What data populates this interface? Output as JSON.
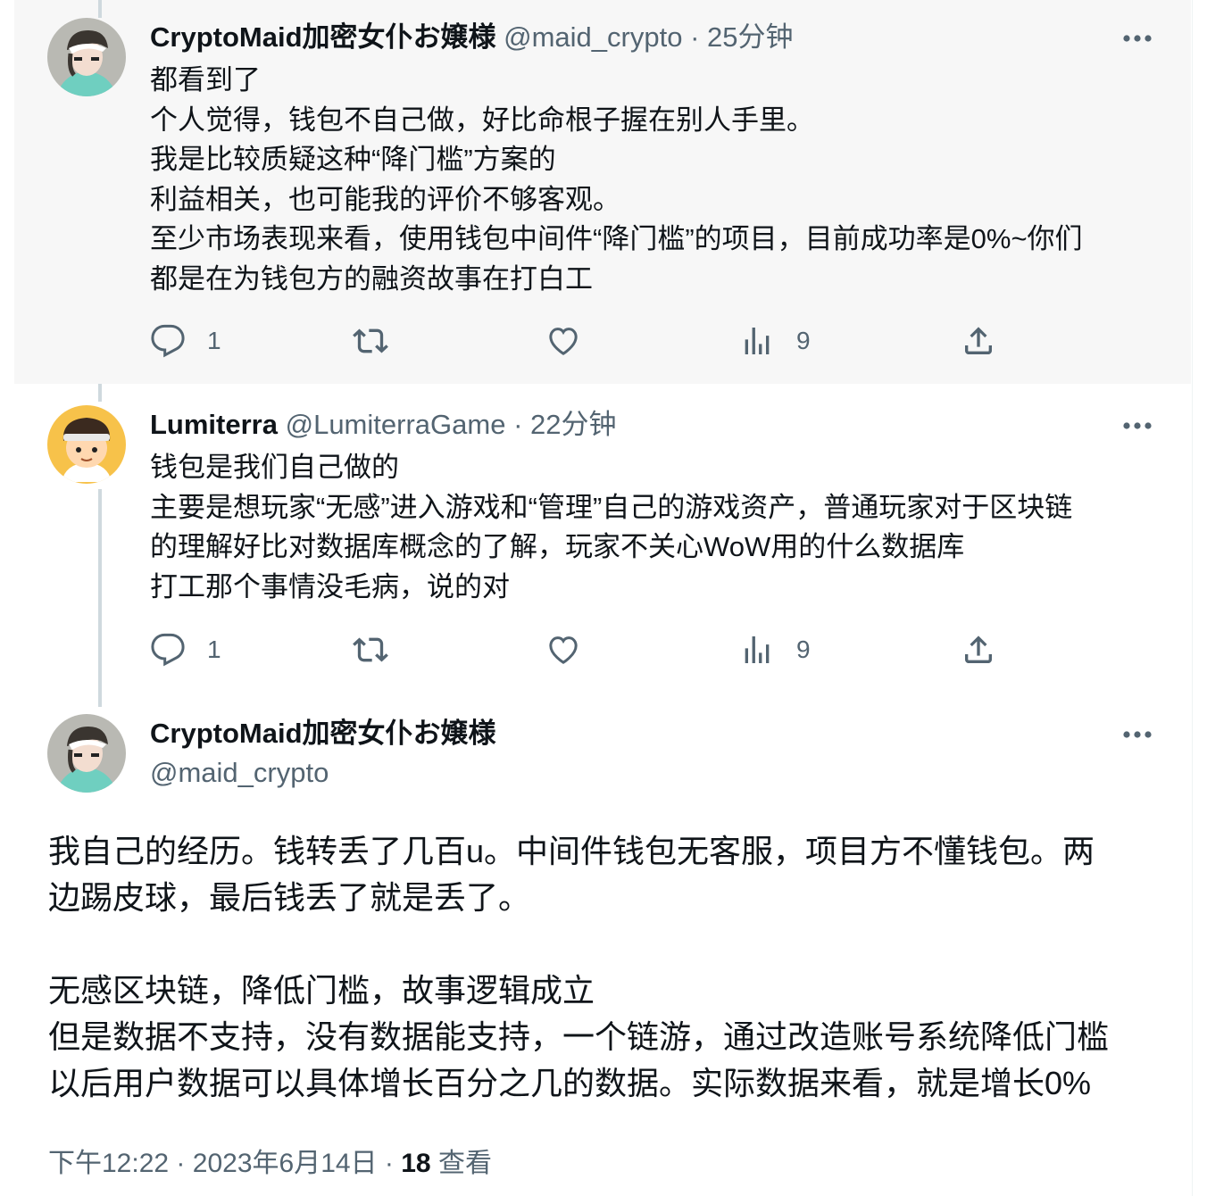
{
  "tweets": [
    {
      "name": "CryptoMaid加密女仆お嬢様",
      "handle": "@maid_crypto",
      "separator": "·",
      "time": "25分钟",
      "lines": [
        "都看到了",
        "个人觉得，钱包不自己做，好比命根子握在别人手里。",
        "我是比较质疑这种“降门槛”方案的",
        "利益相关，也可能我的评价不够客观。",
        "至少市场表现来看，使用钱包中间件“降门槛”的项目，目前成功率是0%~你们",
        "都是在为钱包方的融资故事在打白工"
      ],
      "reply_count": "1",
      "views_count": "9"
    },
    {
      "name": "Lumiterra",
      "handle": "@LumiterraGame",
      "separator": "·",
      "time": "22分钟",
      "lines": [
        "钱包是我们自己做的",
        "主要是想玩家“无感”进入游戏和“管理”自己的游戏资产，普通玩家对于区块链",
        "的理解好比对数据库概念的了解，玩家不关心WoW用的什么数据库",
        "打工那个事情没毛病，说的对"
      ],
      "reply_count": "1",
      "views_count": "9"
    }
  ],
  "main_tweet": {
    "name": "CryptoMaid加密女仆お嬢様",
    "handle": "@maid_crypto",
    "lines": [
      "我自己的经历。钱转丢了几百u。中间件钱包无客服，项目方不懂钱包。两",
      "边踢皮球，最后钱丢了就是丢了。",
      "",
      "无感区块链，降低门槛，故事逻辑成立",
      "但是数据不支持，没有数据能支持，一个链游，通过改造账号系统降低门槛",
      "以后用户数据可以具体增长百分之几的数据。实际数据来看，就是增长0%"
    ],
    "time": "下午12:22",
    "separator": "·",
    "date": "2023年6月14日",
    "views_count": "18",
    "views_label": "查看"
  },
  "icons": {
    "reply": "reply-icon",
    "retweet": "retweet-icon",
    "like": "like-icon",
    "views": "views-icon",
    "share": "share-icon",
    "more": "more-icon",
    "avatar_maid": "maid-avatar",
    "avatar_lumiterra": "lumiterra-avatar"
  },
  "colors": {
    "text_primary": "#0f1419",
    "text_secondary": "#536471",
    "thread_line": "#cfd9de",
    "highlight_bg": "#f7f7f7"
  }
}
